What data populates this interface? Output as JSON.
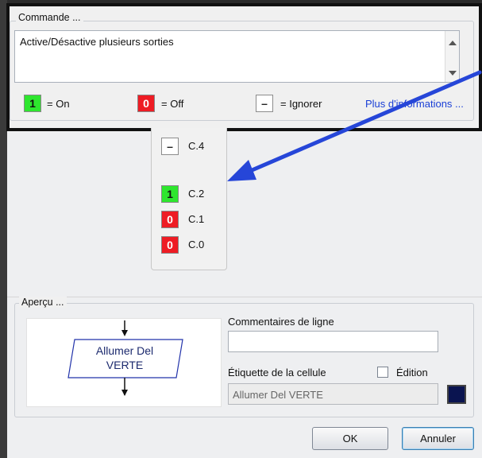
{
  "command": {
    "group_label": "Commande ...",
    "description": "Active/Désactive plusieurs sorties",
    "legend": {
      "on_symbol": "1",
      "on_label": "= On",
      "off_symbol": "0",
      "off_label": "= Off",
      "ignore_symbol": "–",
      "ignore_label": "= Ignorer"
    },
    "more_info_link": "Plus d'informations ..."
  },
  "states": [
    {
      "symbol": "–",
      "name": "C.4",
      "kind": "ignore"
    },
    {
      "symbol": "1",
      "name": "C.2",
      "kind": "on"
    },
    {
      "symbol": "0",
      "name": "C.1",
      "kind": "off"
    },
    {
      "symbol": "0",
      "name": "C.0",
      "kind": "off"
    }
  ],
  "preview": {
    "group_label": "Aperçu ...",
    "flow_block_text_line1": "Allumer Del",
    "flow_block_text_line2": "VERTE"
  },
  "line_comments": {
    "label": "Commentaires de ligne",
    "value": ""
  },
  "cell_label": {
    "label": "Étiquette de la cellule",
    "value": "Allumer Del VERTE",
    "edit_label": "Édition",
    "edit_checked": false
  },
  "swatch_color": "#0a1450",
  "buttons": {
    "ok": "OK",
    "cancel": "Annuler"
  },
  "colors": {
    "on": "#2ee62e",
    "off": "#ee1c24",
    "link": "#1a3fd6",
    "arrow": "#2646d8"
  }
}
